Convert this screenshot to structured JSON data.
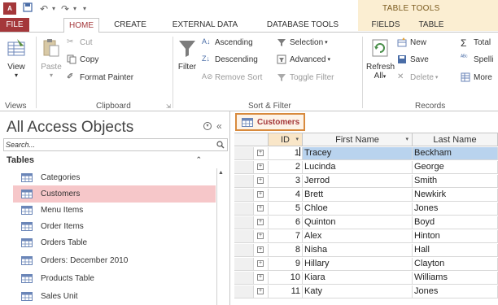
{
  "titlebar": {
    "app_icon_text": "A",
    "context_title": "TABLE TOOLS",
    "context_color": "#fbeed2"
  },
  "ribbon_tabs": [
    "FILE",
    "HOME",
    "CREATE",
    "EXTERNAL DATA",
    "DATABASE TOOLS",
    "FIELDS",
    "TABLE"
  ],
  "ribbon": {
    "views": {
      "view_label": "View",
      "group_label": "Views"
    },
    "clipboard": {
      "paste_label": "Paste",
      "cut_label": "Cut",
      "copy_label": "Copy",
      "format_painter_label": "Format Painter",
      "group_label": "Clipboard"
    },
    "sort_filter": {
      "filter_label": "Filter",
      "ascending_label": "Ascending",
      "descending_label": "Descending",
      "remove_sort_label": "Remove Sort",
      "selection_label": "Selection",
      "advanced_label": "Advanced",
      "toggle_filter_label": "Toggle Filter",
      "group_label": "Sort & Filter"
    },
    "records": {
      "refresh_label": "Refresh",
      "refresh_sub_label": "All",
      "new_label": "New",
      "save_label": "Save",
      "delete_label": "Delete",
      "totals_label": "Total",
      "spelling_label": "Spelli",
      "more_label": "More",
      "group_label": "Records"
    }
  },
  "nav": {
    "title": "All Access Objects",
    "search_placeholder": "Search...",
    "section_label": "Tables",
    "items": [
      {
        "label": "Categories",
        "selected": false
      },
      {
        "label": "Customers",
        "selected": true
      },
      {
        "label": "Menu Items",
        "selected": false
      },
      {
        "label": "Order Items",
        "selected": false
      },
      {
        "label": "Orders Table",
        "selected": false
      },
      {
        "label": "Orders: December 2010",
        "selected": false
      },
      {
        "label": "Products Table",
        "selected": false
      },
      {
        "label": "Sales Unit",
        "selected": false
      }
    ]
  },
  "document": {
    "tab_label": "Customers",
    "columns": {
      "id": "ID",
      "first_name": "First Name",
      "last_name": "Last Name"
    },
    "rows": [
      {
        "id": "1",
        "first": "Tracey",
        "last": "Beckham"
      },
      {
        "id": "2",
        "first": "Lucinda",
        "last": "George"
      },
      {
        "id": "3",
        "first": "Jerrod",
        "last": "Smith"
      },
      {
        "id": "4",
        "first": "Brett",
        "last": "Newkirk"
      },
      {
        "id": "5",
        "first": "Chloe",
        "last": "Jones"
      },
      {
        "id": "6",
        "first": "Quinton",
        "last": "Boyd"
      },
      {
        "id": "7",
        "first": "Alex",
        "last": "Hinton"
      },
      {
        "id": "8",
        "first": "Nisha",
        "last": "Hall"
      },
      {
        "id": "9",
        "first": "Hillary",
        "last": "Clayton"
      },
      {
        "id": "10",
        "first": "Kiara",
        "last": "Williams"
      },
      {
        "id": "11",
        "first": "Katy",
        "last": "Jones"
      }
    ],
    "selected_row": 0
  },
  "colors": {
    "brand": "#a4373a",
    "highlight_tab_border": "#d88a3d",
    "nav_selected": "#f6c7c9",
    "row_selected": "#b9d3ee"
  }
}
